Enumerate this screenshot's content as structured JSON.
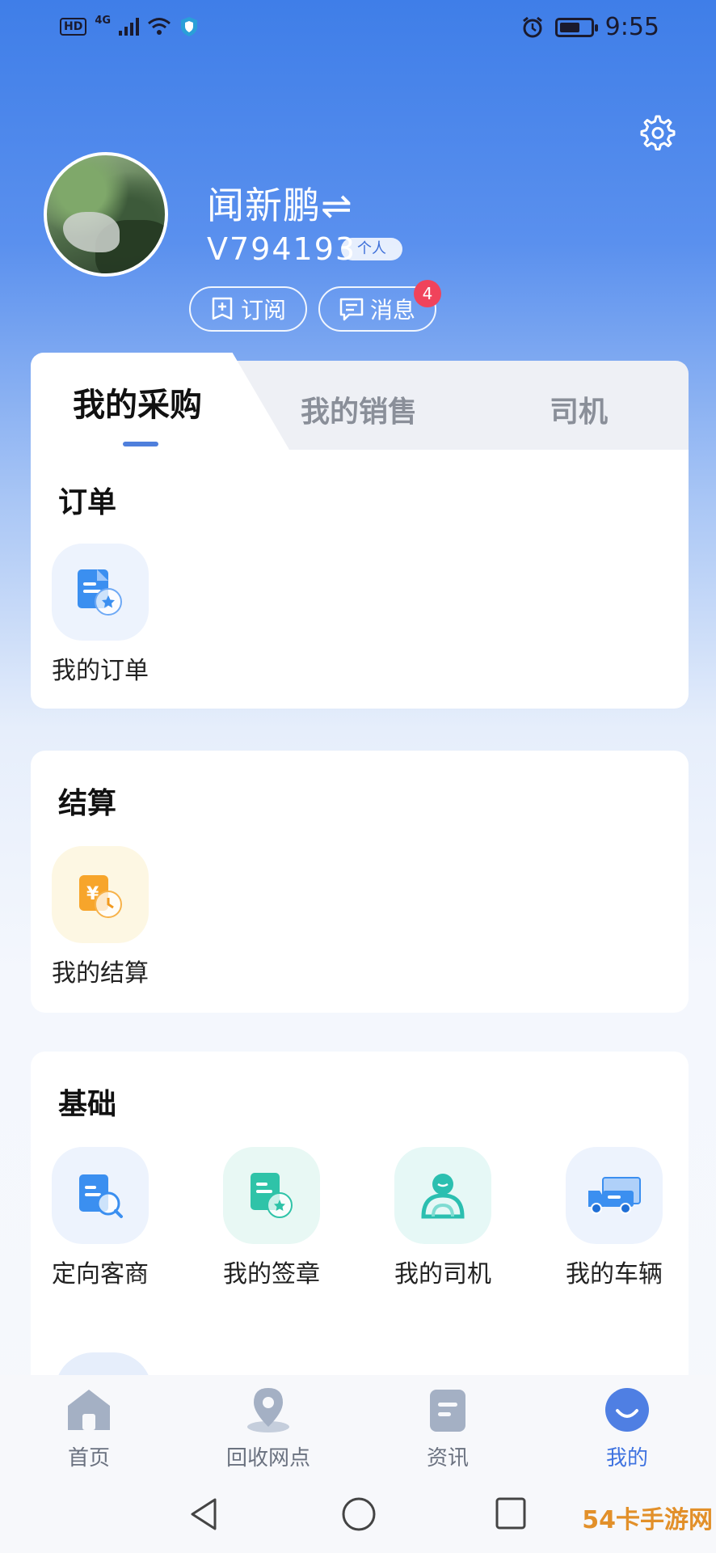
{
  "status_bar": {
    "hd": "HD",
    "network": "4G",
    "time": "9:55"
  },
  "profile": {
    "name": "闻新鹏⇌",
    "id": "V794193",
    "account_type": "个人",
    "subscribe_label": "订阅",
    "message_label": "消息",
    "message_count": "4"
  },
  "tabs": [
    {
      "label": "我的采购",
      "active": true
    },
    {
      "label": "我的销售",
      "active": false
    },
    {
      "label": "司机",
      "active": false
    }
  ],
  "sections": {
    "orders": {
      "title": "订单",
      "items": [
        {
          "label": "我的订单",
          "icon": "order-icon"
        }
      ]
    },
    "settlement": {
      "title": "结算",
      "items": [
        {
          "label": "我的结算",
          "icon": "settlement-icon"
        }
      ]
    },
    "basics": {
      "title": "基础",
      "items": [
        {
          "label": "定向客商",
          "icon": "targeted-merchant-icon"
        },
        {
          "label": "我的签章",
          "icon": "signature-icon"
        },
        {
          "label": "我的司机",
          "icon": "driver-icon"
        },
        {
          "label": "我的车辆",
          "icon": "truck-icon"
        }
      ]
    }
  },
  "bottom_nav": [
    {
      "label": "首页",
      "icon": "home-icon",
      "active": false
    },
    {
      "label": "回收网点",
      "icon": "location-pin-icon",
      "active": false
    },
    {
      "label": "资讯",
      "icon": "news-icon",
      "active": false
    },
    {
      "label": "我的",
      "icon": "profile-icon",
      "active": true
    }
  ],
  "watermark": "54卡手游网",
  "colors": {
    "primary": "#3f73e0",
    "badge_red": "#f0435b",
    "header_blue": "#3f7ee8"
  }
}
